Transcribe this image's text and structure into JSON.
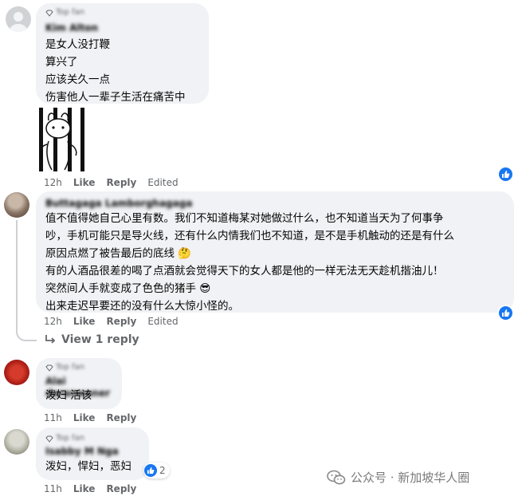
{
  "comments": [
    {
      "badge": "Top fan",
      "name": "Kim Alton",
      "lines": [
        "是女人没打鞭",
        "算兴了",
        "应该关久一点",
        "伤害他人一辈子生活在痛苦中"
      ],
      "time": "12h",
      "like": "Like",
      "reply": "Reply",
      "edited": "Edited"
    },
    {
      "name": "Buttagaga Lamborghagaga",
      "lines": [
        "值不值得她自己心里有数。我们不知道梅某对她做过什么，也不知道当天为了何事争",
        "吵，手机可能只是导火线，还有什么内情我们也不知道，是不是手机触动的还是有什么",
        "原因点燃了被告最后的底线 🤔",
        "有的人酒品很差的喝了点酒就会觉得天下的女人都是他的一样无法无天趁机揩油儿！",
        "突然间人手就变成了色色的猪手 😎",
        "出来走迟早要还的没有什么大惊小怪的。"
      ],
      "time": "12h",
      "like": "Like",
      "reply": "Reply",
      "edited": "Edited",
      "view_reply": "View 1 reply"
    },
    {
      "badge": "Top fan",
      "name": "Alai daranwaner",
      "lines": [
        "泼妇 活该"
      ],
      "time": "11h",
      "like": "Like",
      "reply": "Reply"
    },
    {
      "badge": "Top fan",
      "name": "Isabby M Nga",
      "lines": [
        "泼妇，悍妇，恶妇"
      ],
      "time": "11h",
      "like": "Like",
      "reply": "Reply",
      "reaction_count": "2"
    }
  ],
  "watermark": {
    "text": "公众号 · 新加坡华人圈"
  },
  "icons": {
    "like": "thumbs-up-icon",
    "top_fan": "diamond-icon",
    "reply_arrow": "reply-arrow-icon",
    "wechat": "wechat-icon"
  },
  "colors": {
    "bubble": "#f0f2f5",
    "meta": "#65676b",
    "like_blue": "#1877f2"
  }
}
